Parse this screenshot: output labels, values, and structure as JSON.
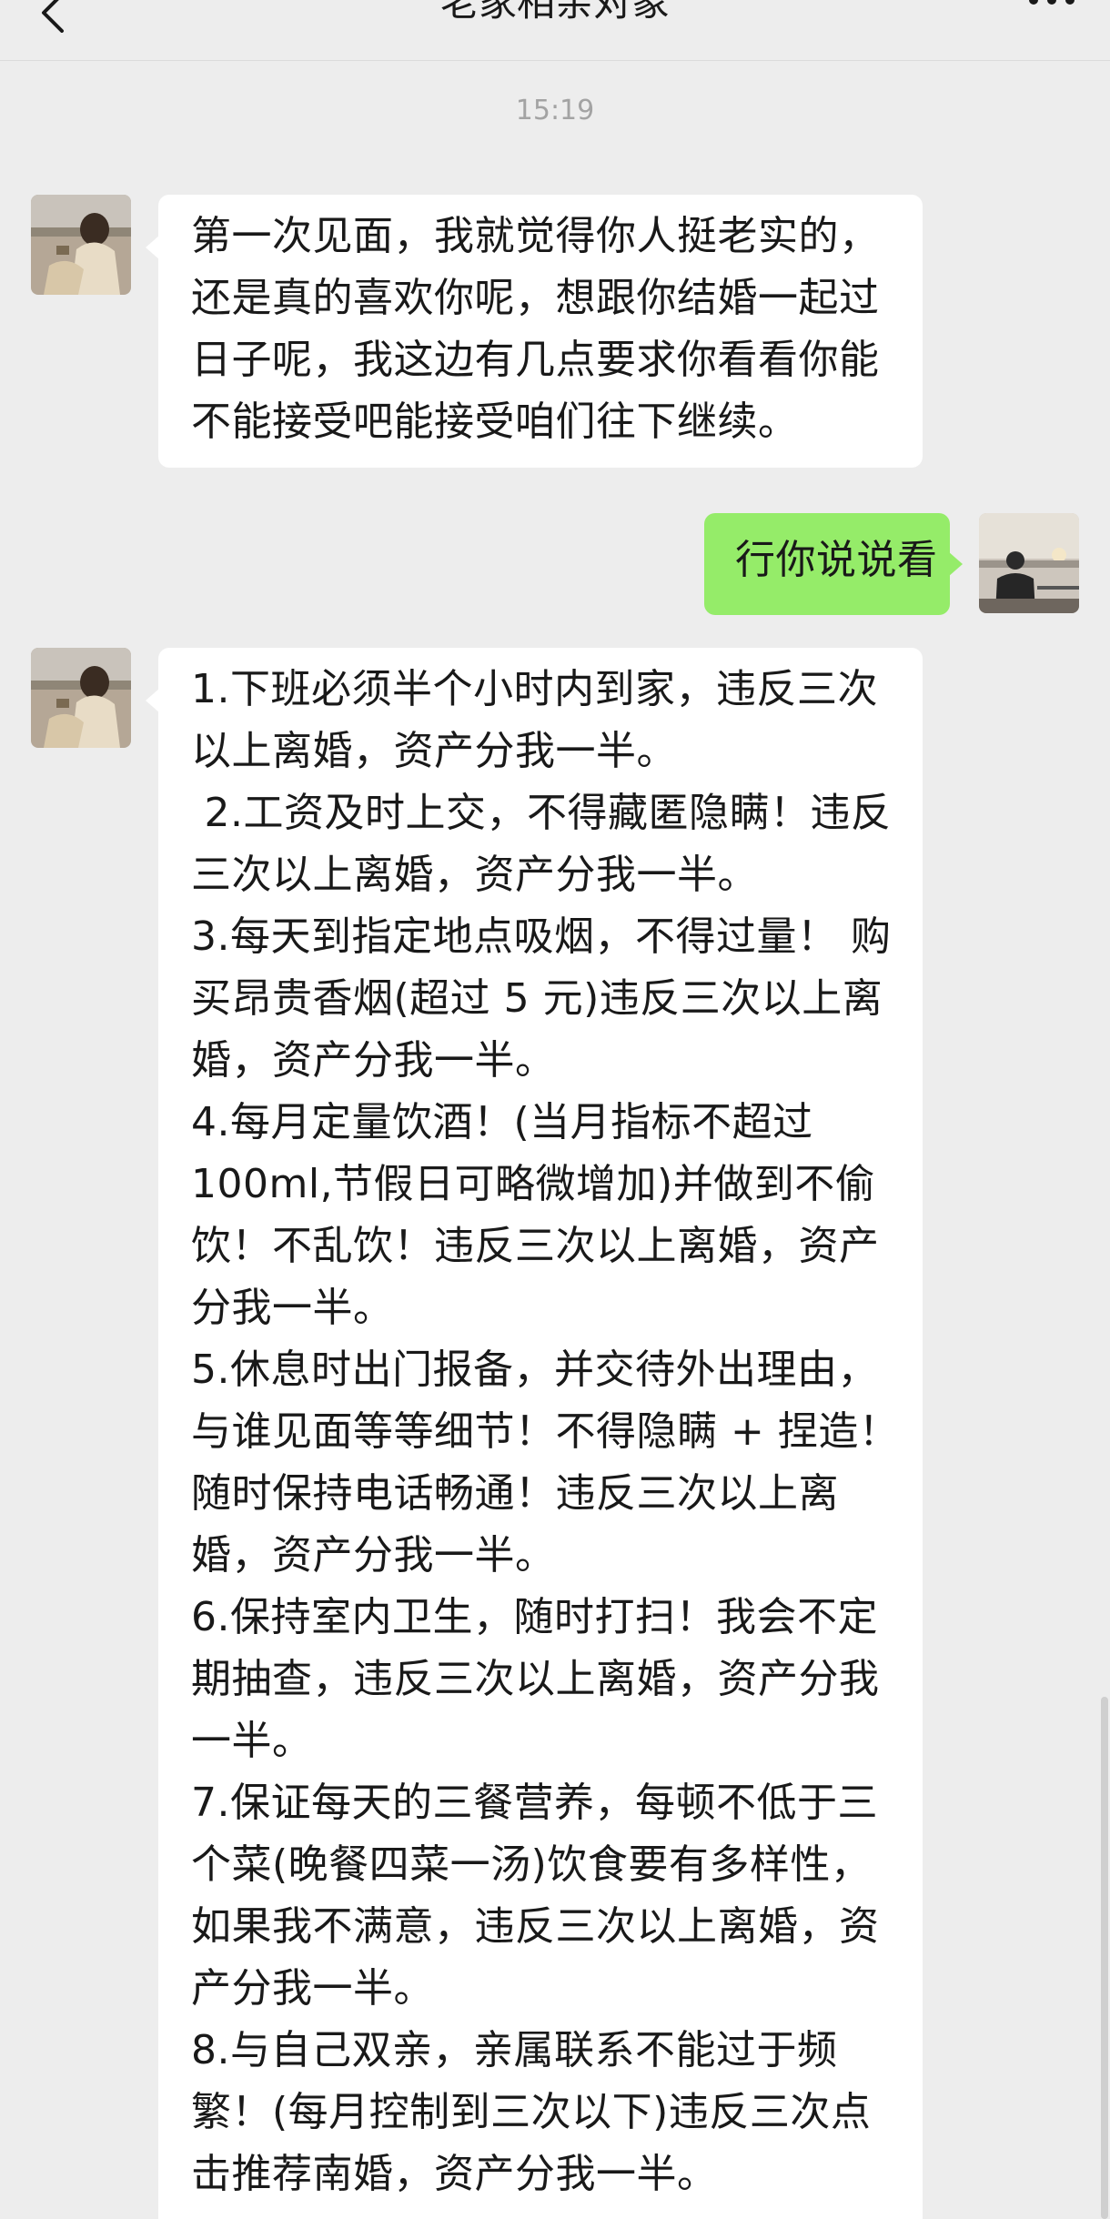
{
  "header": {
    "title": "老家相亲对象",
    "back_icon": "chevron-left-icon",
    "more_icon": "more-dots-icon"
  },
  "timestamp": "15:19",
  "messages": [
    {
      "sender": "contact",
      "avatar": "contact-avatar",
      "lines": [
        "第一次见面，我就觉得你人挺老实的，",
        "还是真的喜欢你呢，想跟你结婚一起过",
        "日子呢，我这边有几点要求你看看你能",
        "不能接受吧能接受咱们往下继续。"
      ]
    },
    {
      "sender": "self",
      "avatar": "self-avatar",
      "text": "行你说说看"
    },
    {
      "sender": "contact",
      "avatar": "contact-avatar",
      "lines": [
        "1.下班必须半个小时内到家，违反三次",
        "以上离婚，资产分我一半。",
        " 2.工资及时上交，不得藏匿隐瞒！违反",
        "三次以上离婚，资产分我一半。",
        "3.每天到指定地点吸烟，不得过量！ 购",
        "买昂贵香烟(超过 5 元)违反三次以上离",
        "婚，资产分我一半。",
        "4.每月定量饮酒！(当月指标不超过",
        "100ml,节假日可略微增加)并做到不偷",
        "饮！不乱饮！违反三次以上离婚，资产",
        "分我一半。",
        "5.休息时出门报备，并交待外出理由，",
        "与谁见面等等细节！不得隐瞒 + 捏造！",
        "随时保持电话畅通！违反三次以上离",
        "婚，资产分我一半。",
        "6.保持室内卫生，随时打扫！我会不定",
        "期抽查，违反三次以上离婚，资产分我",
        "一半。",
        "7.保证每天的三餐营养，每顿不低于三",
        "个菜(晚餐四菜一汤)饮食要有多样性，",
        "如果我不满意，违反三次以上离婚，资",
        "产分我一半。",
        "8.与自己双亲，亲属联系不能过于频",
        "繁！(每月控制到三次以下)违反三次点",
        "击推荐南婚，资产分我一半。"
      ]
    }
  ],
  "colors": {
    "background": "#ededed",
    "incoming_bubble": "#ffffff",
    "outgoing_bubble": "#95ec69",
    "timestamp_text": "#a3a3a3"
  }
}
